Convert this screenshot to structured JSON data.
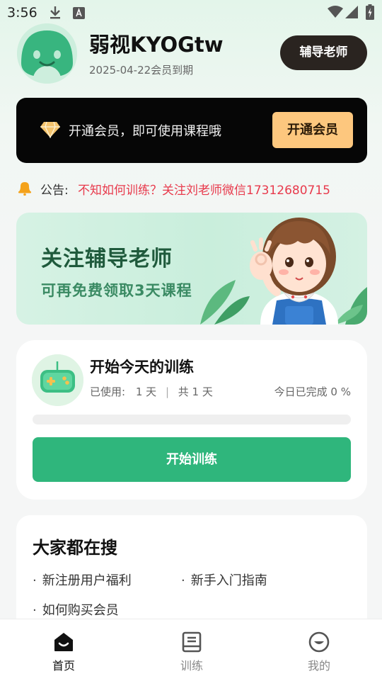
{
  "status_bar": {
    "time": "3:56",
    "icons": [
      "download-icon",
      "keyboard-a-icon",
      "wifi-icon",
      "signal-icon",
      "battery-icon"
    ]
  },
  "header": {
    "username": "弱视KYOGtw",
    "expire_text": "2025-04-22会员到期",
    "tutor_button": "辅导老师"
  },
  "vip_banner": {
    "text": "开通会员，即可使用课程哦",
    "button": "开通会员"
  },
  "notice": {
    "label": "公告:",
    "text": "不知如何训练？关注刘老师微信17312680715"
  },
  "promo": {
    "title": "关注辅导老师",
    "subtitle": "可再免费领取3天课程"
  },
  "training": {
    "title": "开始今天的训练",
    "used_label": "已使用:",
    "used_value": "1 天",
    "total": "共 1 天",
    "today_label": "今日已完成 0 %",
    "progress_fraction": 0,
    "start_button": "开始训练"
  },
  "search": {
    "title": "大家都在搜",
    "items": [
      "新注册用户福利",
      "新手入门指南",
      "如何购买会员"
    ]
  },
  "bottom_nav": {
    "items": [
      {
        "label": "首页",
        "icon": "home-icon",
        "active": true
      },
      {
        "label": "训练",
        "icon": "book-icon",
        "active": false
      },
      {
        "label": "我的",
        "icon": "profile-icon",
        "active": false
      }
    ]
  },
  "colors": {
    "accent_green": "#2fb67c",
    "notice_red": "#e83a4c",
    "vip_gold": "#fdc77e",
    "dark_button": "#2a2420"
  }
}
